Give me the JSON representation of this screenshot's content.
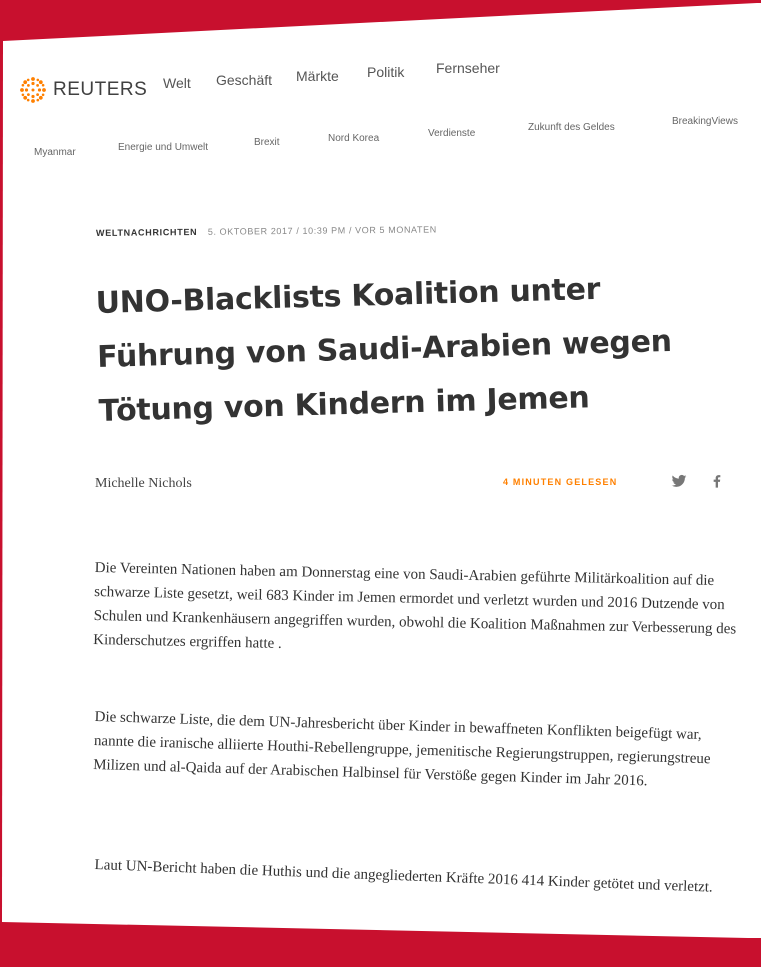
{
  "header": {
    "brand": "REUTERS",
    "nav_primary": [
      "Welt",
      "Geschäft",
      "Märkte",
      "Politik",
      "Fernseher"
    ],
    "nav_secondary": [
      "Myanmar",
      "Energie und Umwelt",
      "Brexit",
      "Nord Korea",
      "Verdienste",
      "Zukunft des Geldes",
      "BreakingViews"
    ]
  },
  "article": {
    "section": "WELTNACHRICHTEN",
    "date": "5. OKTOBER 2017 / 10:39 PM / VOR 5 MONATEN",
    "headline": "UNO-Blacklists Koalition unter Führung von Saudi-Arabien wegen Tötung von Kindern im Jemen",
    "author": "Michelle Nichols",
    "read_time": "4 MINUTEN GELESEN",
    "paragraphs": [
      "Die Vereinten Nationen haben am Donnerstag eine von Saudi-Arabien geführte Militärkoalition auf die schwarze Liste gesetzt, weil 683 Kinder im Jemen ermordet und verletzt wurden und 2016 Dutzende von Schulen und Krankenhäusern angegriffen wurden, obwohl die Koalition Maßnahmen zur Verbesserung des Kinderschutzes ergriffen hatte .",
      "Die schwarze Liste, die dem UN-Jahresbericht über Kinder in bewaffneten Konflikten beigefügt war, nannte die iranische alliierte Houthi-Rebellengruppe, jemenitische Regierungstruppen, regierungstreue Milizen und al-Qaida auf der Arabischen Halbinsel für Verstöße gegen Kinder im Jahr 2016.",
      "Laut UN-Bericht haben die Huthis und die angegliederten Kräfte 2016 414 Kinder getötet und verletzt."
    ]
  },
  "colors": {
    "background": "#c8102e",
    "brand_orange": "#ff8000",
    "text": "#333333"
  },
  "icons": [
    "reuters-logo-icon",
    "twitter-icon",
    "facebook-icon"
  ]
}
